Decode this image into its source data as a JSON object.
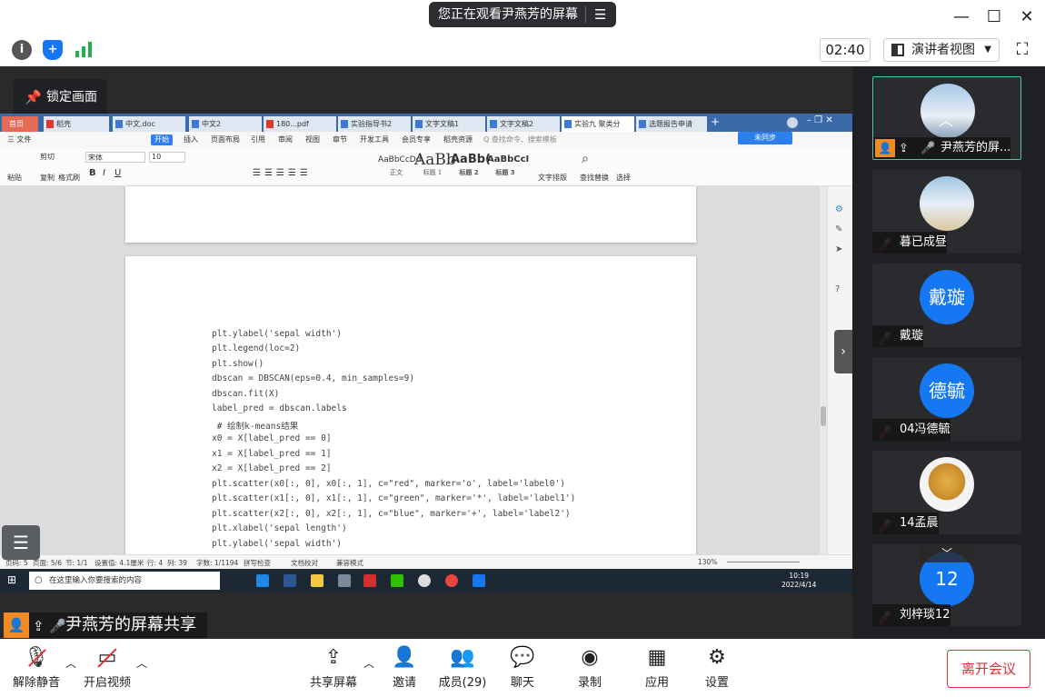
{
  "window": {
    "share_banner": "您正在观看尹燕芳的屏幕",
    "timer": "02:40",
    "view_mode": "演讲者视图"
  },
  "stage": {
    "lock_label": "锁定画面",
    "sharer_label": "尹燕芳的屏幕共享"
  },
  "wps": {
    "tabs": [
      "首页",
      "稻壳",
      "中文.doc",
      "中文2",
      "180...pdf",
      "实验指导书2",
      "文字文稿1",
      "文字文稿2",
      "实验九 聚类分",
      "选题报告申请"
    ],
    "menu": [
      "三 文件",
      "开始",
      "插入",
      "页面布局",
      "引用",
      "审阅",
      "视图",
      "章节",
      "开发工具",
      "会员专享",
      "稻壳资源",
      "Q 查找命令、搜索模板"
    ],
    "sync_label": "未同步",
    "ribbon": {
      "paste": "粘贴",
      "cut": "剪切",
      "copy": "复制",
      "format_painter": "格式刷",
      "font": "宋体",
      "size": "10",
      "styles": [
        {
          "sample": "AaBbCcDd",
          "name": "正文"
        },
        {
          "sample": "AaBb",
          "name": "标题 1"
        },
        {
          "sample": "AaBb(",
          "name": "标题 2"
        },
        {
          "sample": "AaBbCcI",
          "name": "标题 3"
        }
      ],
      "text_layout": "文字排版",
      "find_replace": "查找替换",
      "select": "选择"
    },
    "code_lines": [
      "plt.ylabel('sepal width')",
      "plt.legend(loc=2)",
      "plt.show()",
      "dbscan = DBSCAN(eps=0.4, min_samples=9)",
      "dbscan.fit(X)",
      "label_pred = dbscan.labels",
      " # 绘制k-means结果",
      "x0 = X[label_pred == 0]",
      "x1 = X[label_pred == 1]",
      "x2 = X[label_pred == 2]",
      "plt.scatter(x0[:, 0], x0[:, 1], c=\"red\", marker='o', label='label0')",
      "plt.scatter(x1[:, 0], x1[:, 1], c=\"green\", marker='*', label='label1')",
      "plt.scatter(x2[:, 0], x2[:, 1], c=\"blue\", marker='+', label='label2')",
      "plt.xlabel('sepal length')",
      "plt.ylabel('sepal width')"
    ],
    "status": {
      "page": "页码: 5",
      "pages": "页面: 5/6",
      "section": "节: 1/1",
      "setting": "设置值: 4.1厘米",
      "row": "行: 4",
      "col": "列: 39",
      "words": "字数: 1/1194",
      "spell": "拼写检查",
      "proof": "文档校对",
      "compat": "兼容模式",
      "zoom": "130%"
    },
    "taskbar": {
      "search_placeholder": "在这里输入你要搜索的内容",
      "time": "10:19",
      "date": "2022/4/14"
    }
  },
  "participants": [
    {
      "name": "尹燕芳的屏...",
      "avatar_text": "",
      "muted": false,
      "active": true
    },
    {
      "name": "暮已成昼",
      "avatar_text": "",
      "muted": true,
      "active": false
    },
    {
      "name": "戴璇",
      "avatar_text": "戴璇",
      "muted": true,
      "active": false
    },
    {
      "name": "04冯德毓",
      "avatar_text": "德毓",
      "muted": true,
      "active": false
    },
    {
      "name": "14孟晨",
      "avatar_text": "",
      "muted": true,
      "active": false
    },
    {
      "name": "刘梓琰12",
      "avatar_text": "12",
      "muted": true,
      "active": false
    }
  ],
  "toolbar": {
    "unmute": "解除静音",
    "start_video": "开启视频",
    "share_screen": "共享屏幕",
    "invite": "邀请",
    "members": "成员(29)",
    "chat": "聊天",
    "record": "录制",
    "apps": "应用",
    "settings": "设置",
    "leave": "离开会议"
  },
  "colors": {
    "accent": "#1677f2",
    "leave": "#e0303a",
    "active_tile_border": "#4fc6a1",
    "wps_tabbar": "#3b6aa8"
  },
  "icons": {
    "shield": "shield-icon",
    "signal": "signal-icon",
    "info": "info-icon"
  }
}
